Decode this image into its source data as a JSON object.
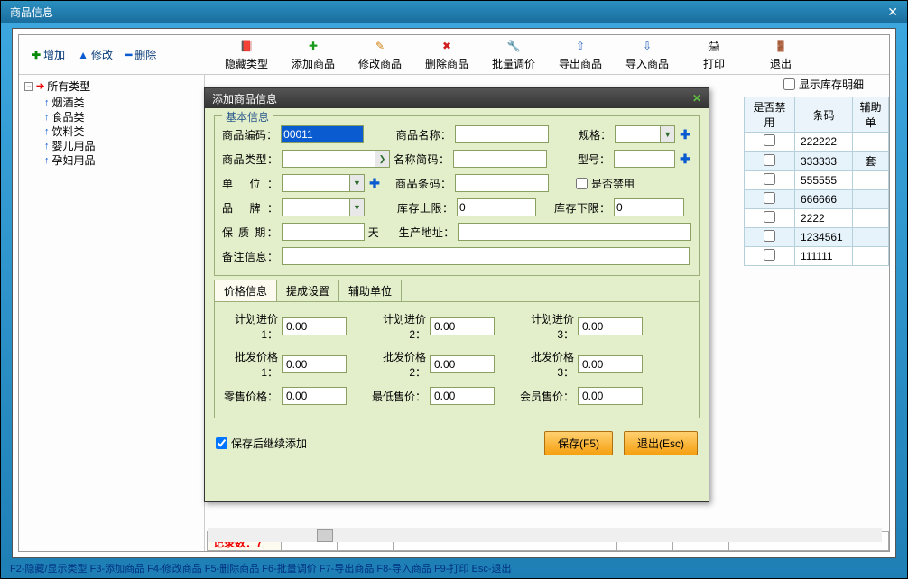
{
  "window": {
    "title": "商品信息"
  },
  "left_toolbar": {
    "add": "增加",
    "modify": "修改",
    "delete": "删除"
  },
  "main_toolbar": [
    {
      "icon": "📁",
      "label": "隐藏类型"
    },
    {
      "icon": "➕",
      "label": "添加商品"
    },
    {
      "icon": "✏️",
      "label": "修改商品"
    },
    {
      "icon": "✖️",
      "label": "删除商品"
    },
    {
      "icon": "🔧",
      "label": "批量调价"
    },
    {
      "icon": "📤",
      "label": "导出商品"
    },
    {
      "icon": "📥",
      "label": "导入商品"
    },
    {
      "icon": "🖨",
      "label": "打印"
    },
    {
      "icon": "🚪",
      "label": "退出"
    }
  ],
  "tree": {
    "root": "所有类型",
    "items": [
      "烟酒类",
      "食品类",
      "饮料类",
      "婴儿用品",
      "孕妇用品"
    ]
  },
  "right": {
    "show_stock_detail": "显示库存明细",
    "col_ban": "是否禁用",
    "col_barcode": "条码",
    "col_aux": "辅助单",
    "rows": [
      {
        "barcode": "222222",
        "aux": ""
      },
      {
        "barcode": "333333",
        "aux": "套"
      },
      {
        "barcode": "555555",
        "aux": ""
      },
      {
        "barcode": "666666",
        "aux": ""
      },
      {
        "barcode": "2222",
        "aux": ""
      },
      {
        "barcode": "1234561",
        "aux": ""
      },
      {
        "barcode": "111111",
        "aux": ""
      }
    ]
  },
  "status": {
    "label": "记录数：",
    "count": "7"
  },
  "footer": "F2-隐藏/显示类型   F3-添加商品 F4-修改商品 F5-删除商品 F6-批量调价 F7-导出商品 F8-导入商品 F9-打印 Esc-退出",
  "modal": {
    "title": "添加商品信息",
    "basic_title": "基本信息",
    "labels": {
      "code": "商品编码：",
      "name": "商品名称：",
      "spec": "规格：",
      "type": "商品类型：",
      "pinyin": "名称简码：",
      "model": "型号：",
      "unit": "单   位：",
      "barcode": "商品条码：",
      "ban": "是否禁用",
      "brand": "品   牌：",
      "stock_up": "库存上限：",
      "stock_down": "库存下限：",
      "shelf": "保 质 期：",
      "day": "天",
      "origin": "生产地址：",
      "remark": "备注信息："
    },
    "values": {
      "code": "00011",
      "stock_up": "0",
      "stock_down": "0"
    },
    "tabs": {
      "price": "价格信息",
      "commission": "提成设置",
      "aux": "辅助单位"
    },
    "price_labels": {
      "plan1": "计划进价1：",
      "plan2": "计划进价2：",
      "plan3": "计划进价3：",
      "whole1": "批发价格1：",
      "whole2": "批发价格2：",
      "whole3": "批发价格3：",
      "retail": "零售价格：",
      "min": "最低售价：",
      "member": "会员售价："
    },
    "price_values": {
      "plan1": "0.00",
      "plan2": "0.00",
      "plan3": "0.00",
      "whole1": "0.00",
      "whole2": "0.00",
      "whole3": "0.00",
      "retail": "0.00",
      "min": "0.00",
      "member": "0.00"
    },
    "save_continue": "保存后继续添加",
    "btn_save": "保存(F5)",
    "btn_exit": "退出(Esc)"
  }
}
